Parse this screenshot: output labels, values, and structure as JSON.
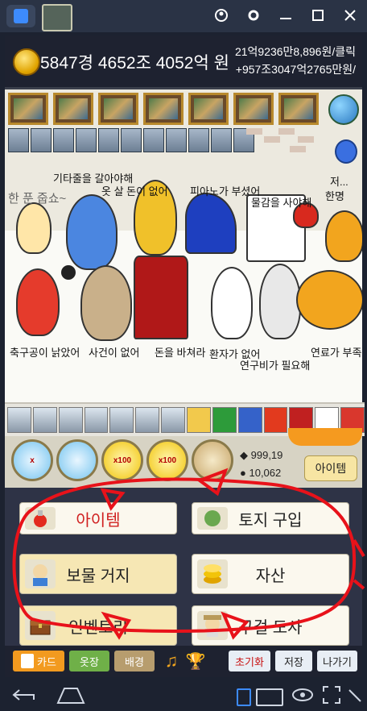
{
  "window": {
    "home_icon": "home-icon",
    "app_icon": "game-app-icon",
    "controls": [
      "account-icon",
      "settings-icon",
      "minimize-icon",
      "maximize-icon",
      "close-icon"
    ]
  },
  "header": {
    "money": "5847경 4652조 4052억 원",
    "rate_click": "21억9236만8,896원/클릭",
    "rate_sec": "+957조3047억2765만원/"
  },
  "scene": {
    "labels": [
      "기타줄을 갈아야해",
      "옷 살 돈이 없어",
      "피아노가 부셨어",
      "물감을 사야해",
      "한 푼 줍쇼~",
      "저...",
      "한명",
      "축구공이 낡았어",
      "사건이 없어",
      "돈을 바쳐라",
      "환자가 없어",
      "연구비가 필요해",
      "연료가 부족해"
    ]
  },
  "stats": {
    "gems": "999,19",
    "bags": "10,062",
    "item_button": "아이템"
  },
  "boosters": [
    {
      "label": "x",
      "icon": "tap-boost-icon"
    },
    {
      "label": "",
      "icon": "coin-boost-icon"
    },
    {
      "label": "x100",
      "icon": "tap-x100-icon"
    },
    {
      "label": "x100",
      "icon": "coin-x100-icon"
    },
    {
      "label": "",
      "icon": "beggar-master-icon"
    }
  ],
  "menu": {
    "items_label": "아이템",
    "land_label": "토지 구입",
    "beggar_label": "보물 거지",
    "assets_label": "자산",
    "inventory_label": "인벤토리",
    "master_label": "구걸 도사"
  },
  "bottom": {
    "card": "카드",
    "clothes": "옷장",
    "background": "배경",
    "reset": "초기화",
    "save": "저장",
    "exit": "나가기"
  },
  "colors": {
    "accent_orange": "#f59a1f",
    "menu_yellow": "#f6e7b4",
    "annotation_red": "#e8121a"
  }
}
